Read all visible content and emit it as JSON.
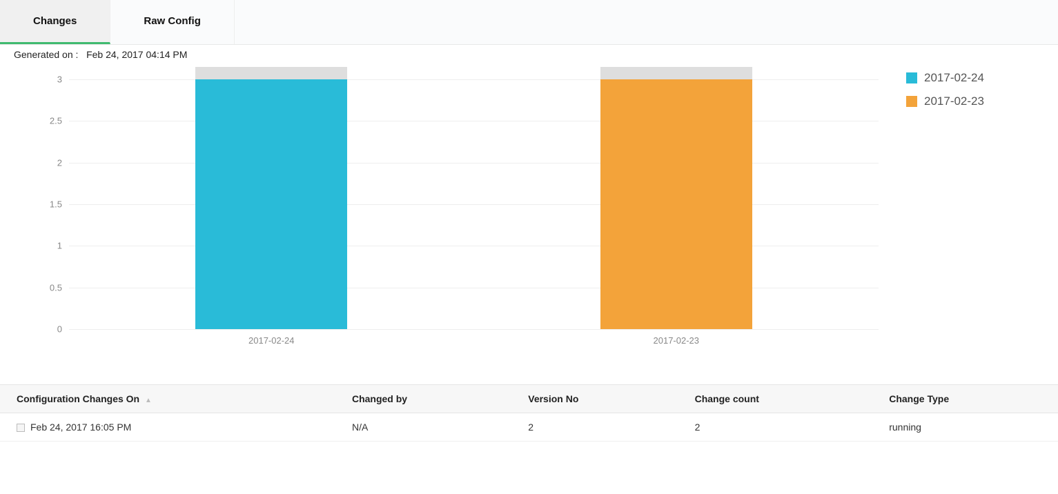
{
  "tabs": {
    "changes": "Changes",
    "raw_config": "Raw Config"
  },
  "generated_label": "Generated on :",
  "generated_value": "Feb 24, 2017 04:14 PM",
  "chart_data": {
    "type": "bar",
    "categories": [
      "2017-02-24",
      "2017-02-23"
    ],
    "values": [
      3,
      3
    ],
    "bg_values": [
      3.15,
      3.15
    ],
    "ylim": [
      0,
      3
    ],
    "yticks": [
      0,
      0.5,
      1,
      1.5,
      2,
      2.5,
      3
    ],
    "title": "",
    "xlabel": "",
    "ylabel": ""
  },
  "legend": [
    {
      "label": "2017-02-24",
      "color": "#29bbd8"
    },
    {
      "label": "2017-02-23",
      "color": "#f3a33a"
    }
  ],
  "colors": {
    "series": [
      "#29bbd8",
      "#f3a33a"
    ],
    "bg_bar": "#dedede"
  },
  "table": {
    "headers": {
      "config_changes_on": "Configuration Changes On",
      "changed_by": "Changed by",
      "version_no": "Version No",
      "change_count": "Change count",
      "change_type": "Change Type"
    },
    "rows": [
      {
        "config_changes_on": "Feb 24, 2017 16:05 PM",
        "changed_by": "N/A",
        "version_no": "2",
        "change_count": "2",
        "change_type": "running"
      }
    ]
  }
}
